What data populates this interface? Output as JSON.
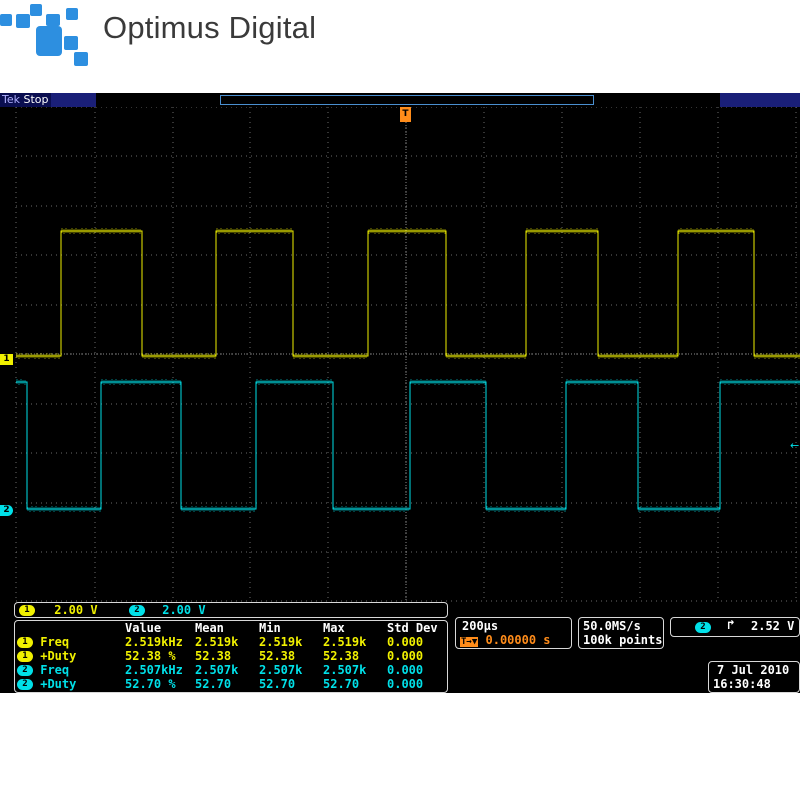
{
  "logo": {
    "text": "Optimus Digital",
    "color": "#2d8fe0"
  },
  "scope": {
    "brand": "Tek",
    "status": "Stop",
    "trigger_marker": "T",
    "ch1_marker": "1",
    "ch2_marker": "2",
    "colors": {
      "ch1": "#f0f000",
      "ch2": "#00e0e8",
      "trigger": "#ff8c1a"
    }
  },
  "channels": {
    "ch1": {
      "num": "1",
      "scale": "2.00 V"
    },
    "ch2": {
      "num": "2",
      "scale": "2.00 V"
    }
  },
  "measurements": {
    "headers": [
      "Value",
      "Mean",
      "Min",
      "Max",
      "Std Dev"
    ],
    "rows": [
      {
        "ch": "1",
        "name": "Freq",
        "value": "2.519kHz",
        "mean": "2.519k",
        "min": "2.519k",
        "max": "2.519k",
        "std": "0.000"
      },
      {
        "ch": "1",
        "name": "+Duty",
        "value": "52.38 %",
        "mean": "52.38",
        "min": "52.38",
        "max": "52.38",
        "std": "0.000"
      },
      {
        "ch": "2",
        "name": "Freq",
        "value": "2.507kHz",
        "mean": "2.507k",
        "min": "2.507k",
        "max": "2.507k",
        "std": "0.000"
      },
      {
        "ch": "2",
        "name": "+Duty",
        "value": "52.70 %",
        "mean": "52.70",
        "min": "52.70",
        "max": "52.70",
        "std": "0.000"
      }
    ]
  },
  "horizontal": {
    "timebase": "200µs",
    "trigger_position": "0.00000 s"
  },
  "acquisition": {
    "sample_rate": "50.0MS/s",
    "record_length": "100k points"
  },
  "trigger": {
    "source": "2",
    "slope_icon": "rising-edge-icon",
    "level": "2.52 V"
  },
  "timestamp": {
    "date": "7 Jul  2010",
    "time": "16:30:48"
  }
}
